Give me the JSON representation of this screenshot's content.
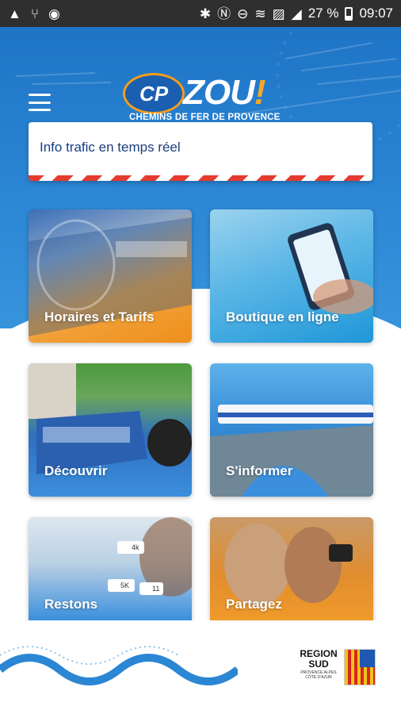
{
  "status_bar": {
    "battery": "27 %",
    "time": "09:07",
    "icons_left": [
      "warning-icon",
      "usb-icon",
      "circle-icon"
    ],
    "icons_right": [
      "bluetooth-icon",
      "nfc-icon",
      "dnd-icon",
      "wifi-icon",
      "no-sim-icon",
      "signal-icon",
      "battery-icon"
    ]
  },
  "header": {
    "logo_badge": "CP",
    "logo_text": "ZOU",
    "logo_bang": "!",
    "logo_subtitle": "CHEMINS DE FER DE PROVENCE",
    "menu_icon": "hamburger-menu-icon"
  },
  "traffic": {
    "lead": "Info trafic",
    "rest": " en temps réel"
  },
  "tiles": [
    {
      "label": "Horaires et Tarifs"
    },
    {
      "label": "Boutique en ligne"
    },
    {
      "label": "Découvrir"
    },
    {
      "label": "S'informer"
    },
    {
      "label": "Restons"
    },
    {
      "label": "Partagez"
    }
  ],
  "social_badges": {
    "followers": "4k",
    "likes": "5K",
    "comments": "11"
  },
  "footer": {
    "region_title": "REGION SUD",
    "region_sub": "PROVENCE ALPES CÔTE D'AZUR"
  },
  "colors": {
    "primary_blue": "#1f74c6",
    "orange": "#f59c1a",
    "stripe_red": "#e43a2f"
  }
}
